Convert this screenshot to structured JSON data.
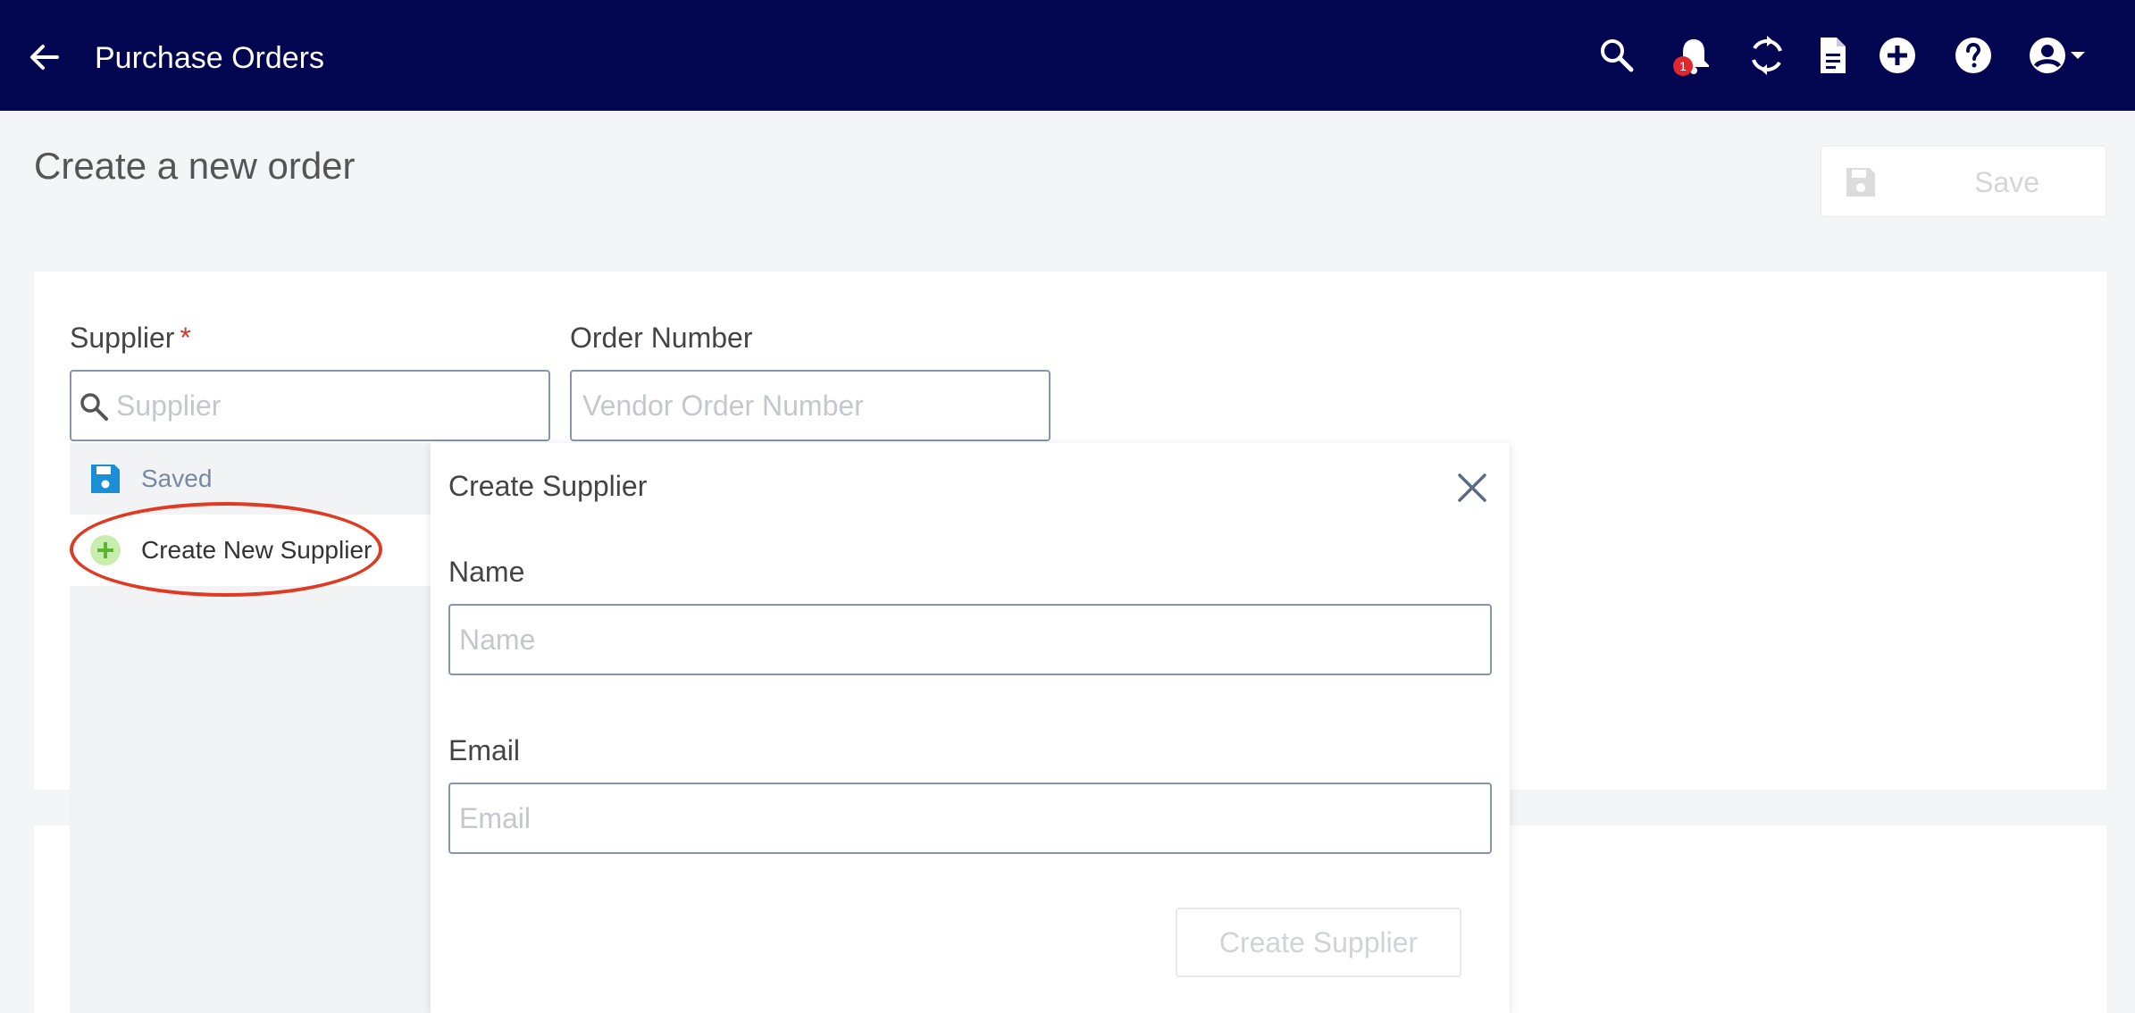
{
  "header": {
    "title": "Purchase Orders",
    "notification_count": "1",
    "icons": [
      "back-arrow-icon",
      "search-icon",
      "bell-icon",
      "sync-icon",
      "document-icon",
      "add-circle-icon",
      "help-icon",
      "account-icon",
      "caret-down-icon"
    ],
    "background_color": "#020650"
  },
  "page": {
    "title": "Create a new order",
    "save_label": "Save"
  },
  "form": {
    "supplier_label": "Supplier",
    "required_mark": "*",
    "supplier_placeholder": "Supplier",
    "order_number_label": "Order Number",
    "order_number_placeholder": "Vendor Order Number"
  },
  "dropdown": {
    "saved_label": "Saved",
    "create_new_label": "Create New Supplier"
  },
  "create_supplier": {
    "title": "Create Supplier",
    "name_label": "Name",
    "name_placeholder": "Name",
    "email_label": "Email",
    "email_placeholder": "Email",
    "submit_label": "Create Supplier"
  },
  "colors": {
    "accent": "#020650",
    "required": "#d0392b",
    "highlight": "#e03a23",
    "saved_icon": "#1a8fd6",
    "add_icon": "#7ac943"
  }
}
